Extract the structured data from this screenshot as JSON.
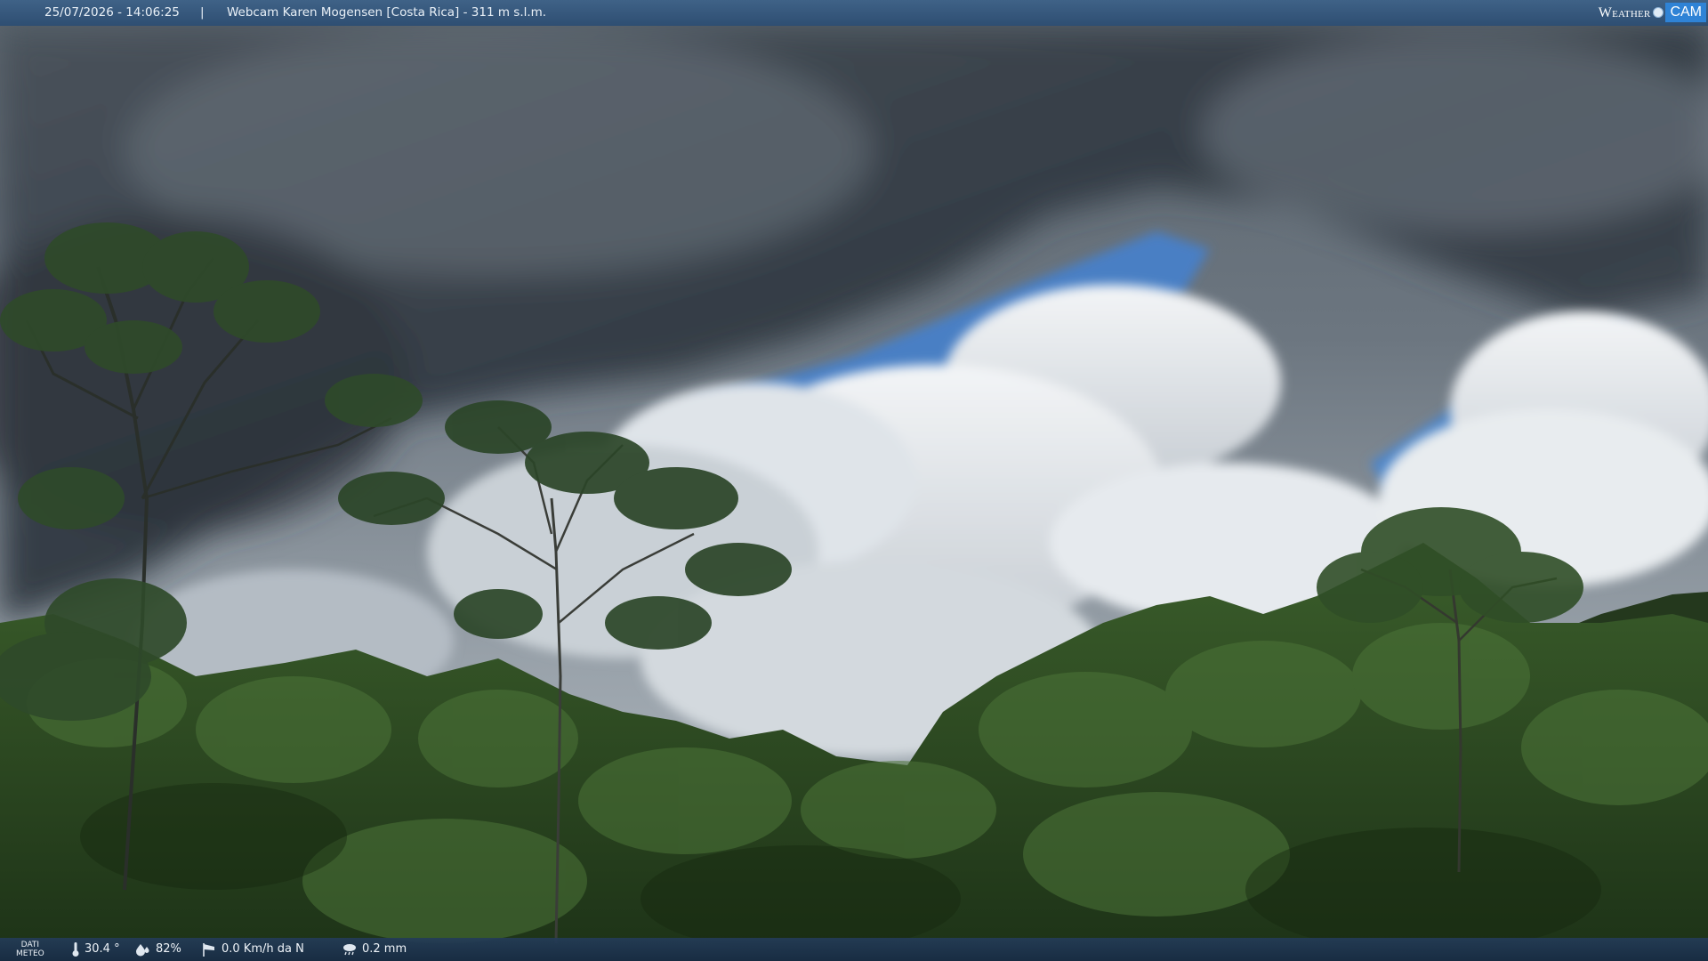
{
  "overlay": {
    "datetime": "25/07/2026 - 14:06:25",
    "separator": "|",
    "title": "Webcam Karen Mogensen [Costa Rica] - 311 m s.l.m.",
    "logo_weather": "Weather",
    "logo_cam": "CAM",
    "logo_icon": "sun-globe-icon"
  },
  "meteo": {
    "label_line1": "DATI",
    "label_line2": "METEO",
    "temperature": "30.4 °",
    "humidity": "82%",
    "wind": "0.0 Km/h da N",
    "rain": "0.2 mm",
    "icons": [
      "thermometer-icon",
      "humidity-drop-icon",
      "wind-sock-icon",
      "rain-cloud-icon"
    ]
  },
  "colors": {
    "bar": "#2e4e72",
    "sky_blue": "#4a7fc4",
    "cloud_dark": "#3d4650",
    "foliage": "#2c4a22",
    "logo_accent": "#2f83d6"
  }
}
